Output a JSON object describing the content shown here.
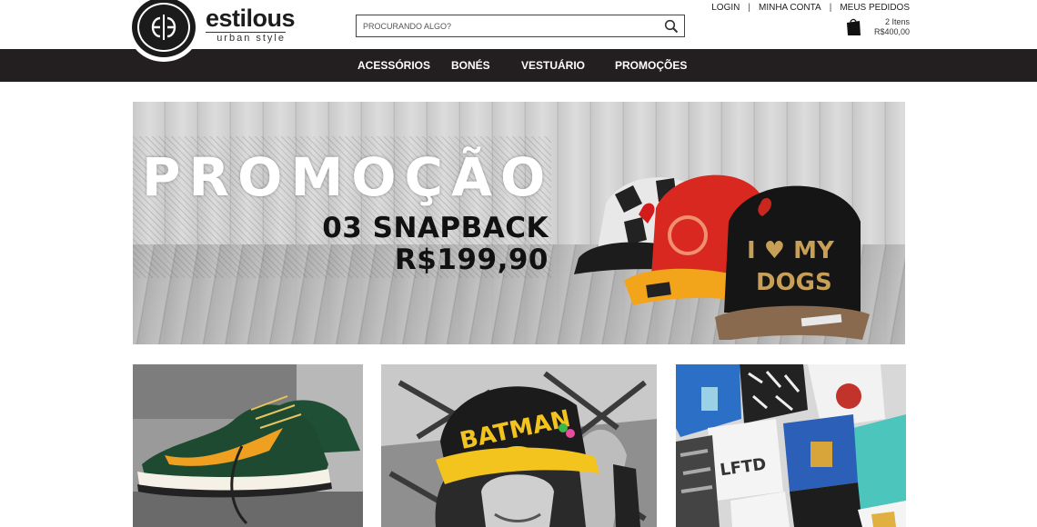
{
  "brand": {
    "name": "estilous",
    "tagline": "urban style"
  },
  "search": {
    "placeholder": "PROCURANDO ALGO?"
  },
  "top_links": {
    "login": "LOGIN",
    "account": "MINHA CONTA",
    "orders": "MEUS PEDIDOS",
    "separator": "|"
  },
  "cart": {
    "items": "2 Itens",
    "total": "R$400,00"
  },
  "nav": {
    "items": [
      {
        "label": "ACESSÓRIOS"
      },
      {
        "label": "BONÉS"
      },
      {
        "label": "VESTUÁRIO"
      },
      {
        "label": "PROMOÇÕES"
      }
    ]
  },
  "hero": {
    "title": "PROMOÇÃO",
    "line1": "03 SNAPBACK",
    "line2": "R$199,90",
    "cap_text_line1": "I ♥ MY",
    "cap_text_line2": "DOGS"
  },
  "tiles": {
    "cap_print": "BATMAN"
  },
  "colors": {
    "nav_bg": "#231f20",
    "brand_dark": "#1b1b1b"
  },
  "icons": {
    "search": "search-icon",
    "cart": "shopping-bag-icon"
  }
}
